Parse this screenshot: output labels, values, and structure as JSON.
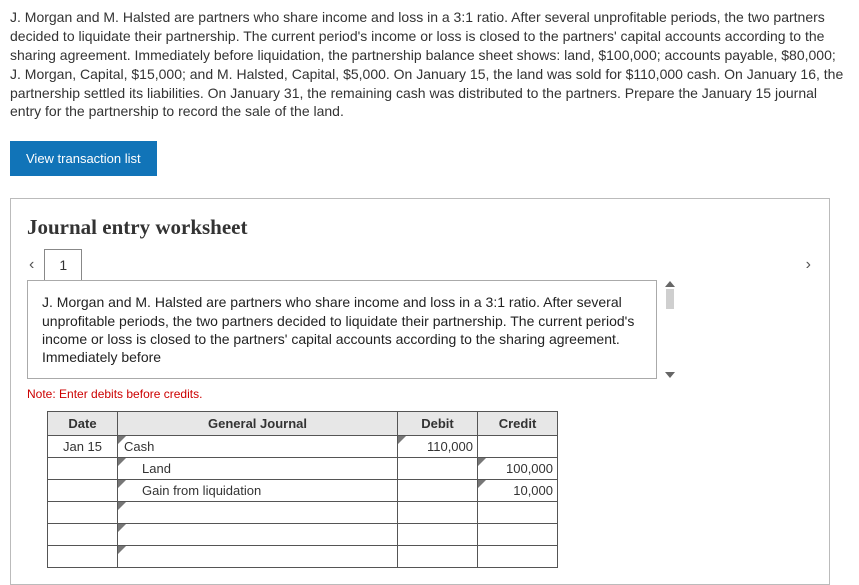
{
  "problem_text": "J. Morgan and M. Halsted are partners who share income and loss in a 3:1 ratio. After several unprofitable periods, the two partners decided to liquidate their partnership. The current period's income or loss is closed to the partners' capital accounts according to the sharing agreement. Immediately before liquidation, the partnership balance sheet shows: land, $100,000; accounts payable, $80,000; J. Morgan, Capital, $15,000; and M. Halsted, Capital, $5,000. On January 15, the land was sold for $110,000 cash. On January 16, the partnership settled its liabilities. On January 31, the remaining cash was distributed to the partners. Prepare the January 15 journal entry for the partnership to record the sale of the land.",
  "button_view": "View transaction list",
  "ws_title": "Journal entry worksheet",
  "tab_1": "1",
  "scenario": "J. Morgan and M. Halsted are partners who share income and loss in a 3:1 ratio. After several unprofitable periods, the two partners decided to liquidate their partnership. The current period's income or loss is closed to the partners' capital accounts according to the sharing agreement. Immediately before",
  "note": "Note: Enter debits before credits.",
  "cols": {
    "date": "Date",
    "gj": "General Journal",
    "debit": "Debit",
    "credit": "Credit"
  },
  "rows": {
    "r1": {
      "date": "Jan 15",
      "account": "Cash",
      "debit": "110,000",
      "credit": ""
    },
    "r2": {
      "date": "",
      "account": "Land",
      "debit": "",
      "credit": "100,000"
    },
    "r3": {
      "date": "",
      "account": "Gain from liquidation",
      "debit": "",
      "credit": "10,000"
    },
    "r4": {
      "date": "",
      "account": "",
      "debit": "",
      "credit": ""
    },
    "r5": {
      "date": "",
      "account": "",
      "debit": "",
      "credit": ""
    },
    "r6": {
      "date": "",
      "account": "",
      "debit": "",
      "credit": ""
    }
  }
}
